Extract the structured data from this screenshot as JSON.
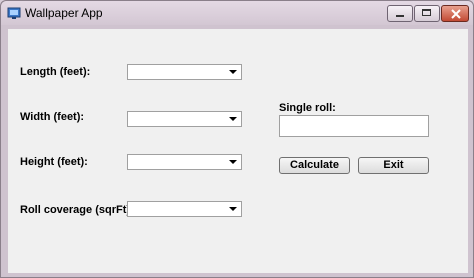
{
  "window": {
    "title": "Wallpaper App"
  },
  "form": {
    "length_label": "Length (feet):",
    "width_label": "Width (feet):",
    "height_label": "Height (feet):",
    "coverage_label": "Roll coverage (sqrFt):",
    "length_value": "",
    "width_value": "",
    "height_value": "",
    "coverage_value": "",
    "single_roll_label": "Single roll:",
    "single_roll_value": ""
  },
  "buttons": {
    "calculate": "Calculate",
    "exit": "Exit"
  },
  "colors": {
    "close_button": "#c24a34",
    "client_background": "#f0f0f0"
  }
}
